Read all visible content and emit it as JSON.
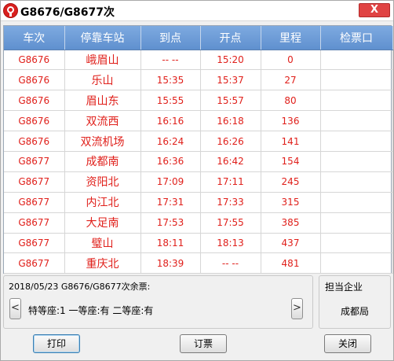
{
  "window": {
    "title": "G8676/G8677次",
    "close_label": "X"
  },
  "grid": {
    "columns": [
      "车次",
      "停靠车站",
      "到点",
      "开点",
      "里程",
      "检票口"
    ],
    "rows": [
      [
        "G8676",
        "峨眉山",
        "-- --",
        "15:20",
        "0",
        ""
      ],
      [
        "G8676",
        "乐山",
        "15:35",
        "15:37",
        "27",
        ""
      ],
      [
        "G8676",
        "眉山东",
        "15:55",
        "15:57",
        "80",
        ""
      ],
      [
        "G8676",
        "双流西",
        "16:16",
        "16:18",
        "136",
        ""
      ],
      [
        "G8676",
        "双流机场",
        "16:24",
        "16:26",
        "141",
        ""
      ],
      [
        "G8677",
        "成都南",
        "16:36",
        "16:42",
        "154",
        ""
      ],
      [
        "G8677",
        "资阳北",
        "17:09",
        "17:11",
        "245",
        ""
      ],
      [
        "G8677",
        "内江北",
        "17:31",
        "17:33",
        "315",
        ""
      ],
      [
        "G8677",
        "大足南",
        "17:53",
        "17:55",
        "385",
        ""
      ],
      [
        "G8677",
        "璧山",
        "18:11",
        "18:13",
        "437",
        ""
      ],
      [
        "G8677",
        "重庆北",
        "18:39",
        "-- --",
        "481",
        ""
      ]
    ]
  },
  "tickets": {
    "caption": "2018/05/23 G8676/G8677次余票:",
    "info": "特等座:1 一等座:有 二等座:有",
    "prev_label": "<",
    "next_label": ">"
  },
  "company": {
    "caption": "担当企业",
    "name": "成都局"
  },
  "buttons": {
    "print": "打印",
    "book": "订票",
    "close": "关闭"
  },
  "colors": {
    "header_bg": "#6a9ad6",
    "row_text": "#e0201b",
    "close_btn": "#e04343"
  }
}
